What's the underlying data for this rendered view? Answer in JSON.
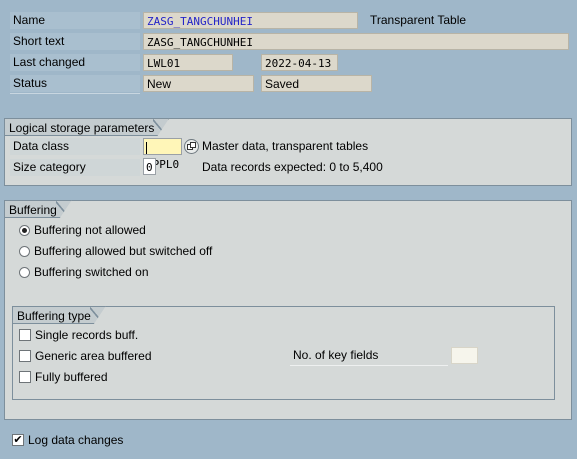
{
  "header": {
    "name_label": "Name",
    "name_value": "ZASG_TANGCHUNHEI",
    "table_type": "Transparent Table",
    "short_text_label": "Short text",
    "short_text_value": "ZASG_TANGCHUNHEI",
    "last_changed_label": "Last changed",
    "last_changed_user": "LWL01",
    "last_changed_date": "2022-04-13",
    "status_label": "Status",
    "status_value": "New",
    "status_saved": "Saved"
  },
  "logical_storage": {
    "title": "Logical storage parameters",
    "data_class_label": "Data class",
    "data_class_value": "APPL0",
    "data_class_desc": "Master data, transparent tables",
    "size_category_label": "Size category",
    "size_category_value": "0",
    "size_category_desc": "Data records expected: 0 to 5,400"
  },
  "buffering": {
    "title": "Buffering",
    "options": [
      {
        "label": "Buffering not allowed",
        "selected": true
      },
      {
        "label": "Buffering allowed but switched off",
        "selected": false
      },
      {
        "label": "Buffering switched on",
        "selected": false
      }
    ]
  },
  "buffering_type": {
    "title": "Buffering type",
    "options": [
      {
        "label": "Single records buff.",
        "checked": false
      },
      {
        "label": "Generic area buffered",
        "checked": false
      },
      {
        "label": "Fully buffered",
        "checked": false
      }
    ],
    "key_fields_label": "No. of key fields",
    "key_fields_value": ""
  },
  "footer": {
    "log_data_changes_label": "Log data changes",
    "log_data_changes_checked": true
  },
  "colors": {
    "background": "#9fb7c9",
    "group_background": "#d5d9d8",
    "display_field": "#dcd8cb",
    "focus_field": "#fff6b8",
    "name_text": "#2424c8"
  },
  "icons": {
    "data_class_help": "value-help-icon"
  }
}
